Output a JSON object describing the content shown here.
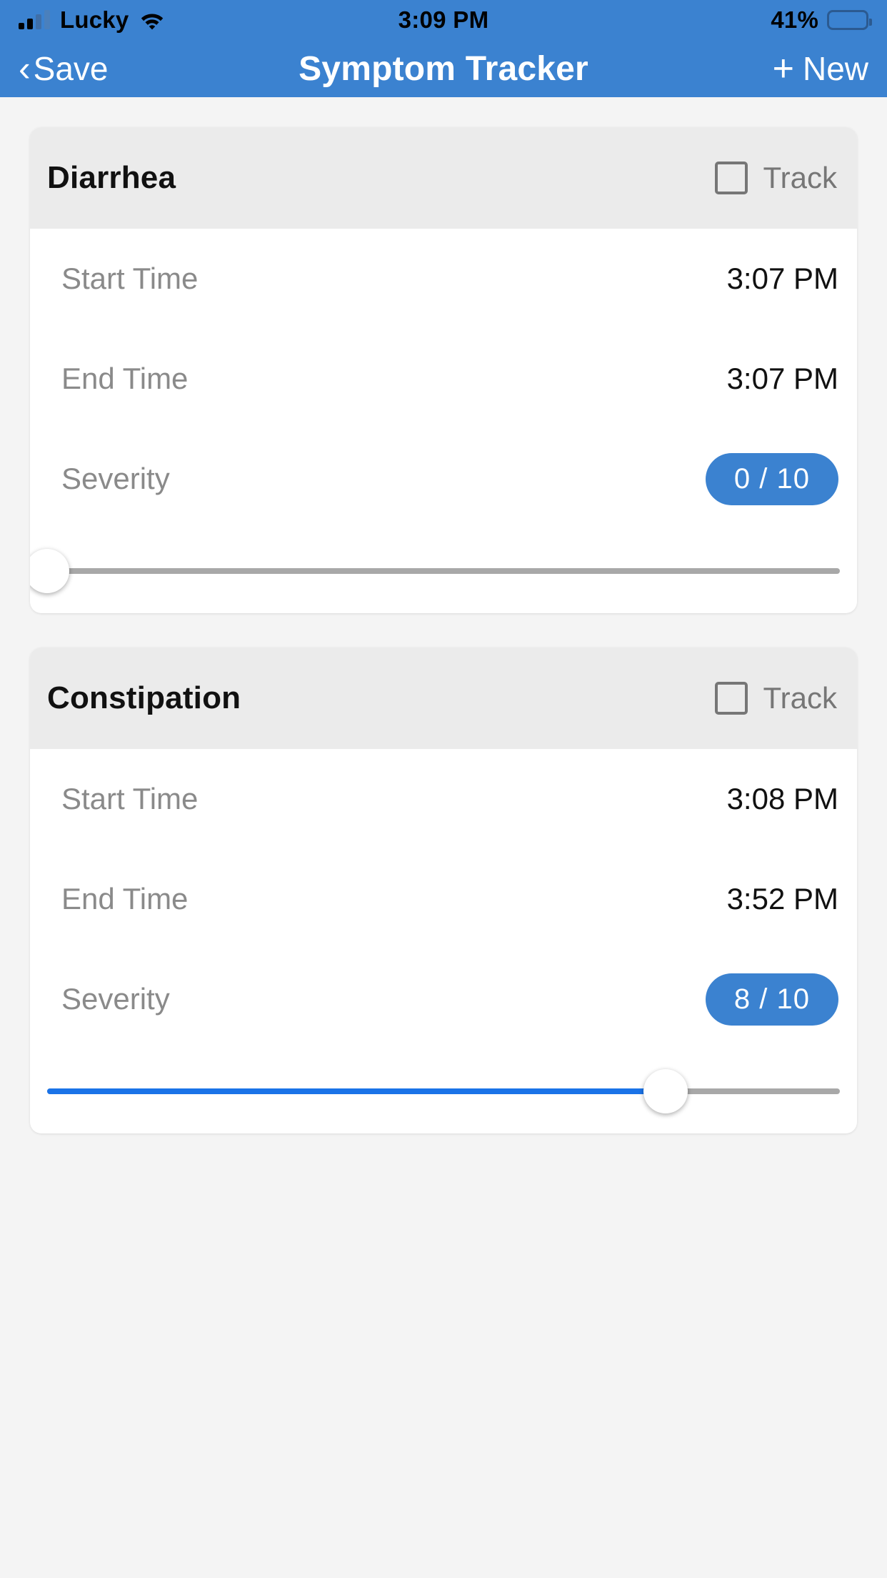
{
  "status_bar": {
    "carrier": "Lucky",
    "time": "3:09 PM",
    "battery_percent": "41%",
    "battery_level": 41,
    "signal_bars_filled": 2,
    "signal_bars_total": 4,
    "wifi_icon": "wifi-icon",
    "battery_icon": "battery-icon"
  },
  "nav_bar": {
    "back_label": "Save",
    "back_icon": "chevron-left-icon",
    "title": "Symptom Tracker",
    "new_label": "New",
    "new_icon": "plus-icon",
    "background_color": "#3b82d0",
    "text_color": "#ffffff"
  },
  "theme": {
    "accent": "#3b82d0",
    "slider_fill": "#1a73e8",
    "page_background": "#f4f4f4",
    "card_background": "#ffffff",
    "card_header_background": "#ebebeb",
    "label_color": "#8a8a8a"
  },
  "cards": [
    {
      "title": "Diarrhea",
      "track_label": "Track",
      "track_checked": false,
      "rows": [
        {
          "label": "Start Time",
          "value": "3:07 PM"
        },
        {
          "label": "End Time",
          "value": "3:07 PM"
        }
      ],
      "severity": {
        "label": "Severity",
        "badge": "0 / 10",
        "value": 0,
        "max": 10,
        "percent": 0
      }
    },
    {
      "title": "Constipation",
      "track_label": "Track",
      "track_checked": false,
      "rows": [
        {
          "label": "Start Time",
          "value": "3:08 PM"
        },
        {
          "label": "End Time",
          "value": "3:52 PM"
        }
      ],
      "severity": {
        "label": "Severity",
        "badge": "8 / 10",
        "value": 8,
        "max": 10,
        "percent": 78
      }
    }
  ]
}
